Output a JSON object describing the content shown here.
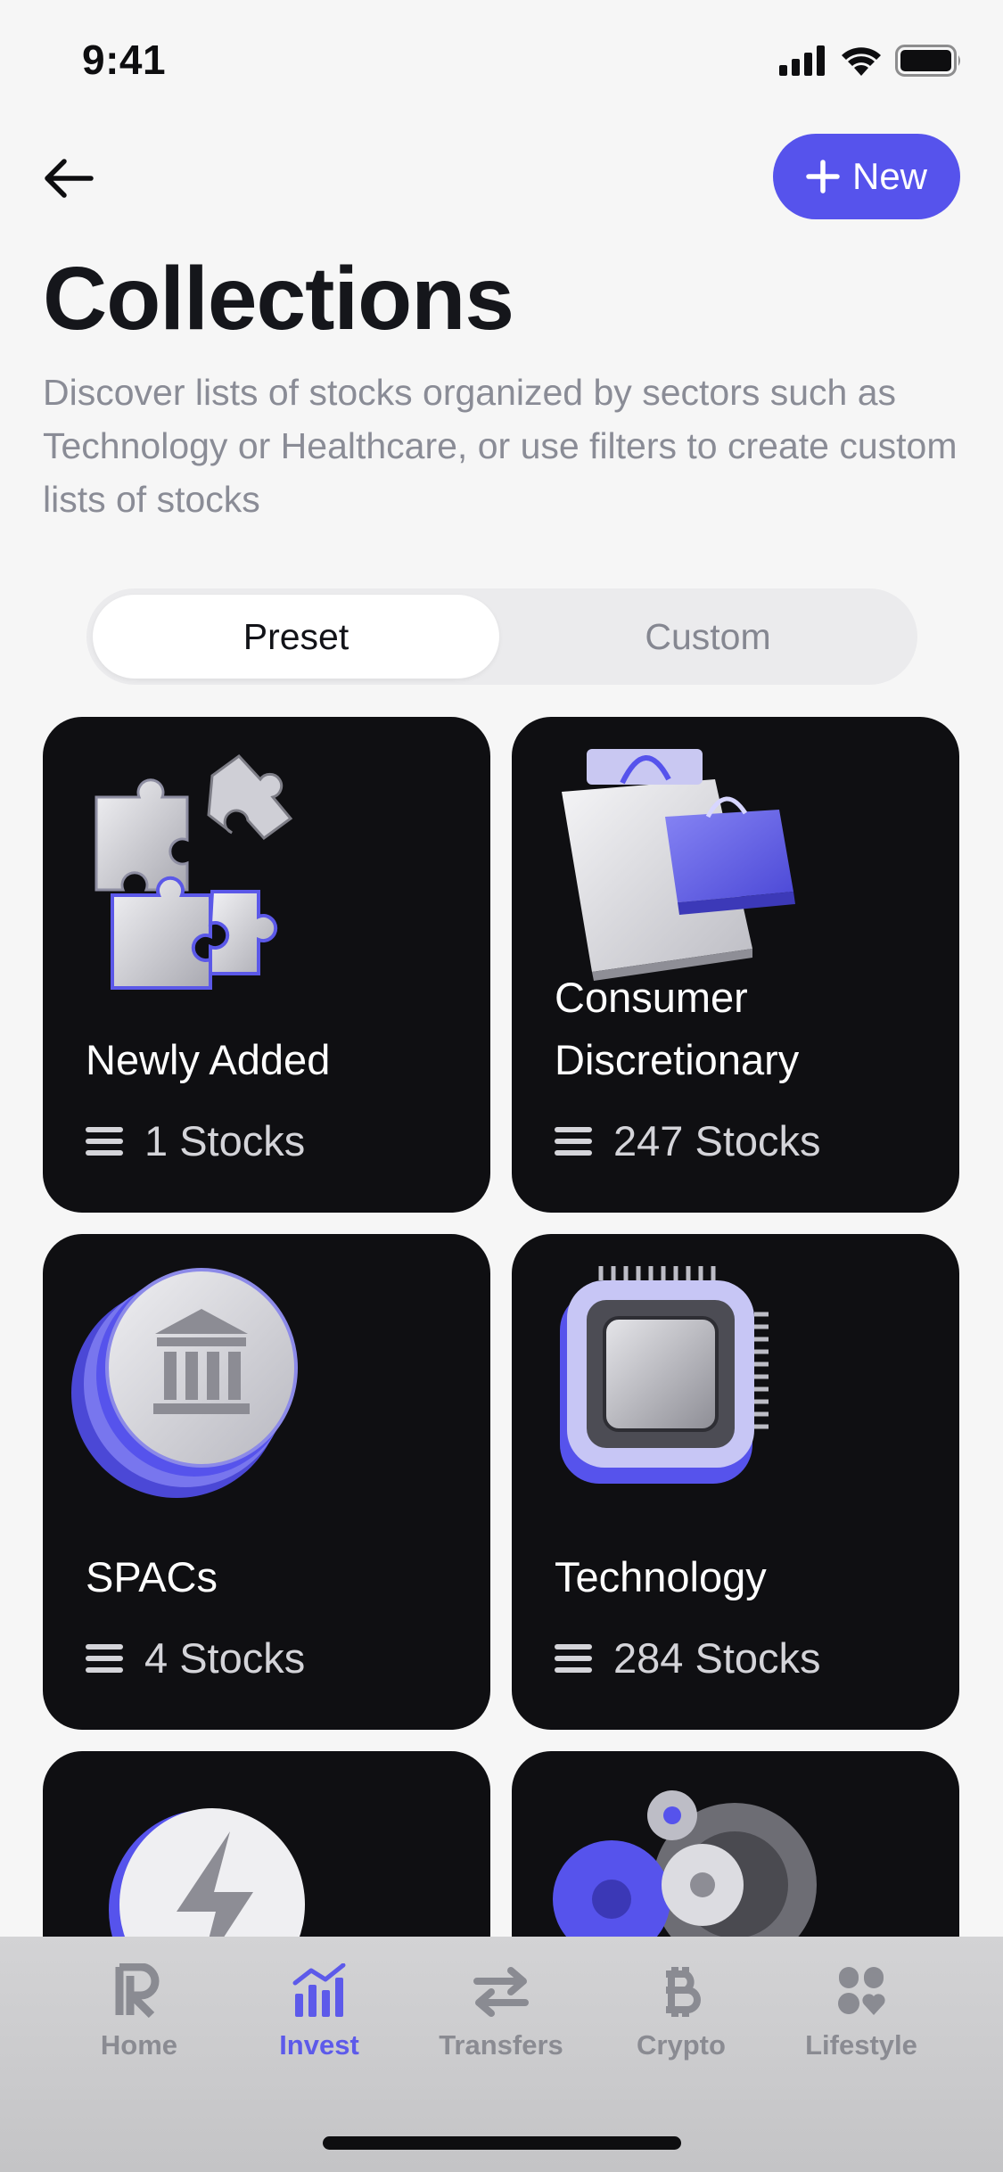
{
  "status_bar": {
    "time": "9:41"
  },
  "header": {
    "new_button_label": "New",
    "title": "Collections",
    "description": "Discover lists of stocks organized by sectors such as Technology or Healthcare, or use filters to create custom lists of stocks"
  },
  "segmented": {
    "preset": "Preset",
    "custom": "Custom",
    "selected": "Preset"
  },
  "cards": [
    {
      "title": "Newly Added",
      "count": "1 Stocks",
      "icon": "puzzle-icon"
    },
    {
      "title": "Consumer Discretionary",
      "count": "247 Stocks",
      "icon": "shopping-bag-icon"
    },
    {
      "title": "SPACs",
      "count": "4 Stocks",
      "icon": "bank-coin-icon"
    },
    {
      "title": "Technology",
      "count": "284 Stocks",
      "icon": "chip-icon"
    },
    {
      "title": "",
      "count": "",
      "icon": "lightning-coin-icon"
    },
    {
      "title": "",
      "count": "",
      "icon": "gears-icon"
    }
  ],
  "tab_bar": {
    "items": [
      {
        "label": "Home",
        "icon": "revolut-logo-icon"
      },
      {
        "label": "Invest",
        "icon": "invest-chart-icon"
      },
      {
        "label": "Transfers",
        "icon": "transfer-arrows-icon"
      },
      {
        "label": "Crypto",
        "icon": "bitcoin-icon"
      },
      {
        "label": "Lifestyle",
        "icon": "lifestyle-icon"
      }
    ],
    "active": "Invest"
  },
  "colors": {
    "accent": "#5653ec",
    "card_bg": "#0f0f12",
    "page_bg": "#f6f6f6"
  }
}
